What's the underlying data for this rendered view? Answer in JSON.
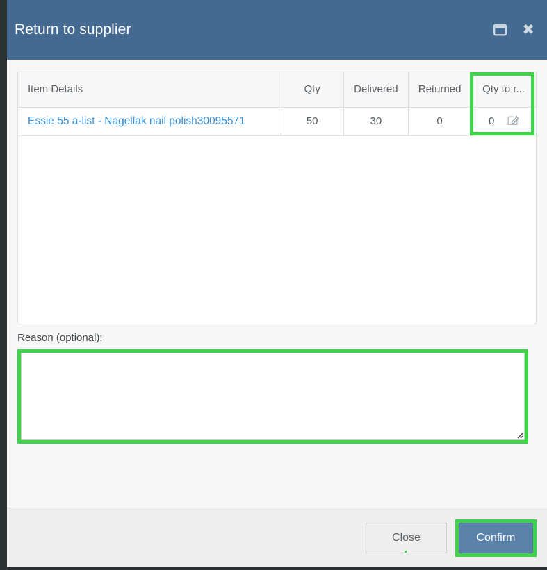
{
  "window": {
    "title": "Return to supplier",
    "maximize_icon": "maximize-icon",
    "close_icon": "close-icon"
  },
  "table": {
    "columns": [
      {
        "key": "item_details",
        "label": "Item Details"
      },
      {
        "key": "qty",
        "label": "Qty"
      },
      {
        "key": "delivered",
        "label": "Delivered"
      },
      {
        "key": "returned",
        "label": "Returned"
      },
      {
        "key": "qty_to_return",
        "label": "Qty to r..."
      }
    ],
    "rows": [
      {
        "item_details": "Essie 55 a-list - Nagellak nail polish30095571",
        "qty": "50",
        "delivered": "30",
        "returned": "0",
        "qty_to_return": "0",
        "edit_icon": "edit-pencil-icon"
      }
    ]
  },
  "reason": {
    "label": "Reason (optional):",
    "value": "",
    "placeholder": ""
  },
  "footer": {
    "close_label": "Close",
    "confirm_label": "Confirm"
  },
  "colors": {
    "titlebar": "#456a91",
    "accent_button": "#5b82ab",
    "highlight": "#3fd24a",
    "link": "#3b8fd4",
    "body_background": "#f7f7f7",
    "footer_background": "#eeeeee",
    "page_backdrop": "#2b3033"
  }
}
